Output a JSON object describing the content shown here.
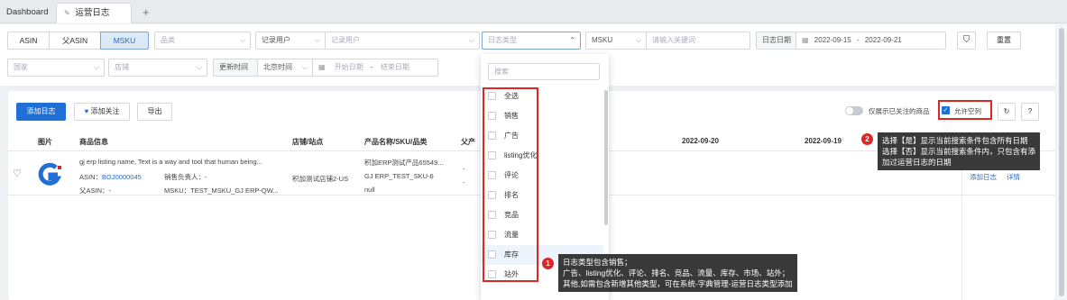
{
  "tabs": {
    "dashboard": "Dashboard",
    "active": "运营日志",
    "add": "+"
  },
  "filters": {
    "seg": [
      "ASIN",
      "父ASIN",
      "MSKU"
    ],
    "category_ph": "品类",
    "record_user_select": "记录用户",
    "record_user_ph": "记录用户",
    "log_type_ph": "日志类型",
    "msku_select": "MSKU",
    "keyword_ph": "请输入关键词",
    "log_date_label": "日志日期",
    "date_from": "2022-09-15",
    "date_sep": "-",
    "date_to": "2022-09-21",
    "reset": "重置",
    "country_ph": "国家",
    "store_ph": "店铺",
    "update_time": "更新时间",
    "beijing_time": "北京时间",
    "start_ph": "开始日期",
    "end_ph": "结束日期"
  },
  "toolbar": {
    "add_log": "添加日志",
    "add_follow": "添加关注",
    "export": "导出",
    "only_followed": "仅展示已关注的商品",
    "allow_empty": "允许空列"
  },
  "table": {
    "headers": [
      "图片",
      "商品信息",
      "店铺/站点",
      "产品名称/SKU/品类",
      "父产",
      "2022-09-20",
      "2022-09-19"
    ],
    "row": {
      "title": "gj erp listing name, Text is a way and tool that human being...",
      "asin_label": "ASIN：",
      "asin": "BGJ0000045",
      "owner": "销售负责人：-",
      "parent": "父ASIN：-",
      "msku": "MSKU：TEST_MSKU_GJ ERP-QW...",
      "store": "积加测试店铺2-US",
      "product": "积加ERP测试产品65549...",
      "sku": "GJ ERP_TEST_SKU-6",
      "cat": "null",
      "dash1": "-",
      "dash2": "-",
      "act_add": "添加日志",
      "act_detail": "详情"
    }
  },
  "dropdown": {
    "search_ph": "搜索",
    "options": [
      "全选",
      "销售",
      "广告",
      "listing优化",
      "评论",
      "排名",
      "竞品",
      "流量",
      "库存",
      "站外"
    ]
  },
  "tooltip_right": {
    "badge": "2",
    "lines": [
      "选择【是】显示当前搜索条件包含所有日期",
      "选择【否】显示当前搜索条件内，只包含有添",
      "加过运营日志的日期"
    ]
  },
  "tooltip_bottom": {
    "badge": "1",
    "lines": [
      "日志类型包含销售；",
      "广告、listing优化、评论、排名、竞品、流量、库存、市场、站外；",
      "其他,如需包含新增其他类型，可在系统-字典管理-运营日志类型添加"
    ]
  },
  "colors": {
    "primary": "#1f6fd6",
    "annotation": "#e02525"
  }
}
